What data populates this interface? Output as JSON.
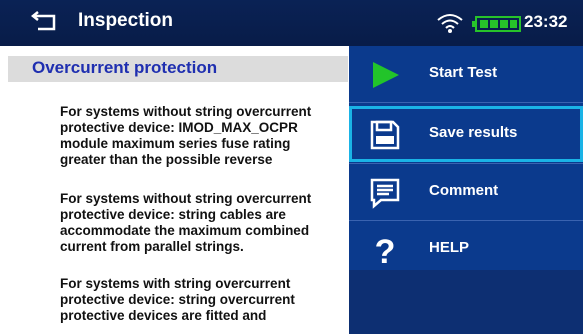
{
  "header": {
    "title": "Inspection",
    "time": "23:32"
  },
  "main": {
    "heading": "Overcurrent protection",
    "paragraphs": [
      [
        "For systems without string overcurrent",
        "protective device: IMOD_MAX_OCPR",
        "module maximum series fuse rating",
        "greater than the possible reverse"
      ],
      [
        "For systems without string overcurrent",
        "protective device: string cables are",
        "accommodate the maximum combined",
        "current from parallel strings."
      ],
      [
        "For systems with string overcurrent",
        "protective device: string overcurrent",
        "protective devices are fitted and"
      ]
    ]
  },
  "menu": {
    "items": [
      {
        "label": "Start Test",
        "icon": "play-icon"
      },
      {
        "label": "Save results",
        "icon": "save-icon"
      },
      {
        "label": "Comment",
        "icon": "comment-icon"
      },
      {
        "label": "HELP",
        "icon": "help-icon"
      }
    ],
    "selected_index": 1
  },
  "colors": {
    "header_bg": "#0a2255",
    "menu_bg": "#0b3a8d",
    "selection": "#1ab3e6",
    "heading_text": "#1f2fb0",
    "battery": "#27c32a",
    "play": "#22c42a"
  }
}
